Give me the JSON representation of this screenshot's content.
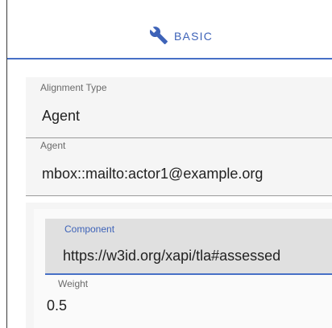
{
  "tabs": [
    {
      "label": "BASIC",
      "icon": "wrench-icon",
      "selected": true
    }
  ],
  "form": {
    "alignment_type": {
      "label": "Alignment Type",
      "value": "Agent"
    },
    "agent": {
      "label": "Agent",
      "value": "mbox::mailto:actor1@example.org"
    },
    "component": {
      "label": "Component",
      "value": "https://w3id.org/xapi/tla#assessed"
    },
    "weight": {
      "label": "Weight",
      "value": "0.5"
    }
  },
  "colors": {
    "accent": "#3e63b8",
    "indicator": "#4770c6",
    "field_bg": "#f5f5f5",
    "focused_field_bg": "#e0e0e0"
  }
}
